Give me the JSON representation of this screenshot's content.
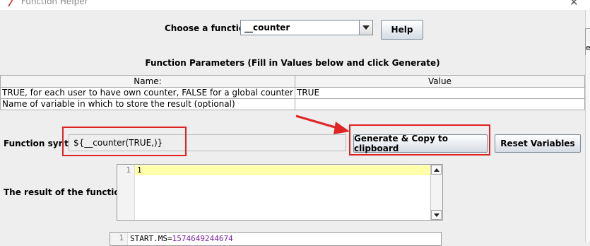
{
  "window": {
    "title": "Function Helper"
  },
  "chooser": {
    "label": "Choose a function",
    "selected": "__counter",
    "help_label": "Help"
  },
  "params": {
    "title": "Function Parameters (Fill in Values below and click Generate)",
    "columns": [
      "Name:",
      "Value"
    ],
    "rows": [
      {
        "name": "TRUE, for each user to have own counter, FALSE for a global counter",
        "value": "TRUE"
      },
      {
        "name": "Name of variable in which to store the result (optional)",
        "value": ""
      }
    ]
  },
  "syntax": {
    "label": "Function syntax:",
    "value": "${__counter(TRUE,)}",
    "generate_label": "Generate & Copy to clipboard",
    "reset_label": "Reset Variables"
  },
  "result": {
    "label": "The result of the function is",
    "line_number": "1",
    "value": "1"
  },
  "variables": {
    "line_number": "1",
    "key": "START.MS=",
    "value": "1574649244674"
  },
  "edge": {
    "partial_label": "e"
  },
  "colors": {
    "annotation_red": "#e02424",
    "highlight_line": "#ffffaa",
    "value_purple": "#7a1fa0"
  }
}
